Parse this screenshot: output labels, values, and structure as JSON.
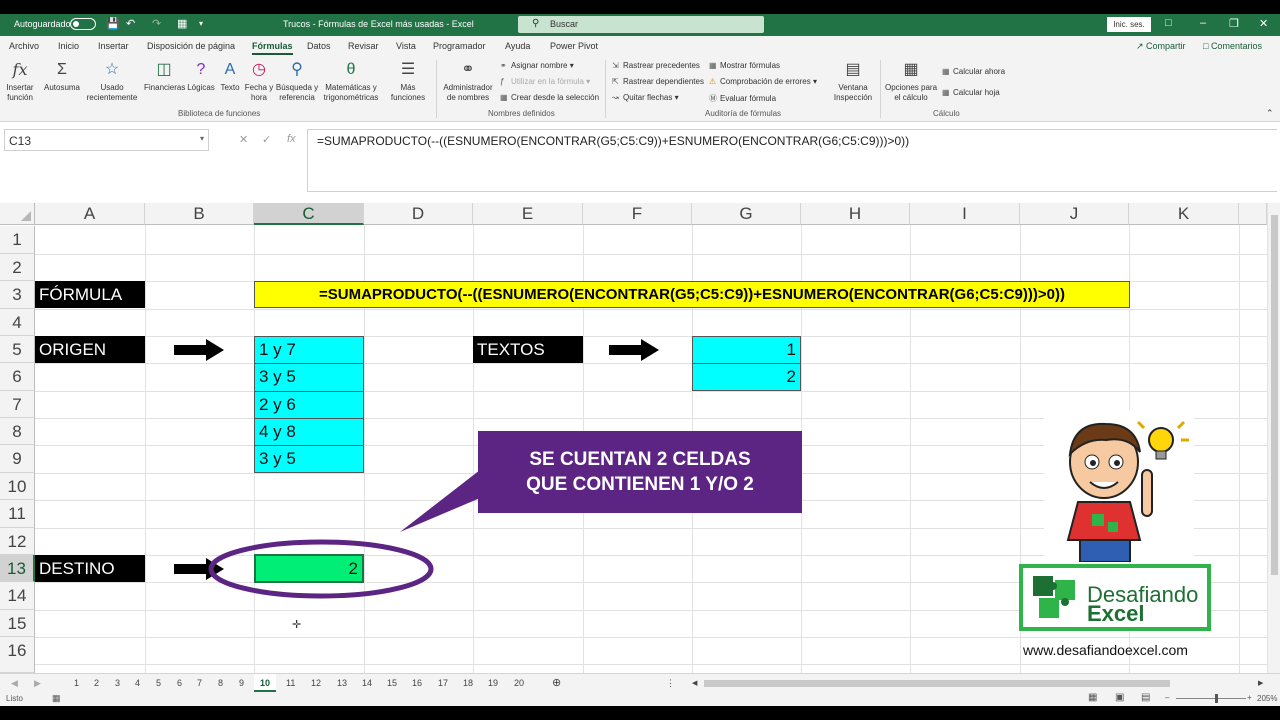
{
  "titlebar": {
    "autosave_label": "Autoguardado",
    "document_title": "Trucos - Fórmulas de Excel más usadas  -  Excel",
    "search_placeholder": "Buscar",
    "signin_label": "Inic. ses."
  },
  "menu": {
    "tabs": [
      "Archivo",
      "Inicio",
      "Insertar",
      "Disposición de página",
      "Fórmulas",
      "Datos",
      "Revisar",
      "Vista",
      "Programador",
      "Ayuda",
      "Power Pivot"
    ],
    "active_tab": "Fórmulas",
    "share_label": "Compartir",
    "comments_label": "Comentarios"
  },
  "ribbon": {
    "insert_function": [
      "Insertar",
      "función"
    ],
    "autosum": [
      "Autosuma",
      ""
    ],
    "recent": [
      "Usado",
      "recientemente"
    ],
    "financial": [
      "Financieras",
      ""
    ],
    "logical": [
      "Lógicas",
      ""
    ],
    "text": [
      "Texto",
      ""
    ],
    "datetime": [
      "Fecha y",
      "hora"
    ],
    "lookup": [
      "Búsqueda y",
      "referencia"
    ],
    "math": [
      "Matemáticas y",
      "trigonométricas"
    ],
    "more": [
      "Más",
      "funciones"
    ],
    "name_manager": [
      "Administrador",
      "de nombres"
    ],
    "define_name": "Asignar nombre",
    "use_in_formula": "Utilizar en la fórmula",
    "create_from_selection": "Crear desde la selección",
    "trace_precedents": "Rastrear precedentes",
    "trace_dependents": "Rastrear dependientes",
    "remove_arrows": "Quitar flechas",
    "show_formulas": "Mostrar fórmulas",
    "error_checking": "Comprobación de errores",
    "evaluate_formula": "Evaluar fórmula",
    "watch_window": [
      "Ventana",
      "Inspección"
    ],
    "calc_options": [
      "Opciones para",
      "el cálculo"
    ],
    "calc_now": "Calcular ahora",
    "calc_sheet": "Calcular hoja",
    "group_library": "Biblioteca de funciones",
    "group_names": "Nombres definidos",
    "group_audit": "Auditoría de fórmulas",
    "group_calc": "Cálculo"
  },
  "formula_bar": {
    "name_box": "C13",
    "formula": "=SUMAPRODUCTO(--((ESNUMERO(ENCONTRAR(G5;C5:C9))+ESNUMERO(ENCONTRAR(G6;C5:C9)))>0))"
  },
  "grid": {
    "columns": [
      "A",
      "B",
      "C",
      "D",
      "E",
      "F",
      "G",
      "H",
      "I",
      "J",
      "K"
    ],
    "rows": [
      "1",
      "2",
      "3",
      "4",
      "5",
      "6",
      "7",
      "8",
      "9",
      "10",
      "11",
      "12",
      "13",
      "14",
      "15",
      "16"
    ],
    "selected_column": "C",
    "selected_row": "13"
  },
  "cells": {
    "formula_label": "FÓRMULA",
    "formula_text": "=SUMAPRODUCTO(--((ESNUMERO(ENCONTRAR(G5;C5:C9))+ESNUMERO(ENCONTRAR(G6;C5:C9)))>0))",
    "origin_label": "ORIGEN",
    "origin_values": [
      "1 y 7",
      "3 y 5",
      "2 y 6",
      "4 y 8",
      "3 y 5"
    ],
    "texts_label": "TEXTOS",
    "texts_values": [
      "1",
      "2"
    ],
    "dest_label": "DESTINO",
    "dest_value": "2"
  },
  "callout": {
    "line1": "SE CUENTAN 2 CELDAS",
    "line2": "QUE CONTIENEN 1 Y/O 2"
  },
  "brand": {
    "logo_line1": "Desafiando",
    "logo_line2": "Excel",
    "website": "www.desafiandoexcel.com"
  },
  "sheet_tabs": {
    "tabs": [
      "1",
      "2",
      "3",
      "4",
      "5",
      "6",
      "7",
      "8",
      "9",
      "10",
      "11",
      "12",
      "13",
      "14",
      "15",
      "16",
      "17",
      "18",
      "19",
      "20"
    ],
    "active": "10"
  },
  "status": {
    "ready": "Listo",
    "zoom": "205%"
  },
  "colors": {
    "excel_green": "#217346",
    "cyan_cell": "#00ffff",
    "yellow_band": "#ffff00",
    "dest_cell": "#00ee76",
    "callout_purple": "#5c2483"
  }
}
